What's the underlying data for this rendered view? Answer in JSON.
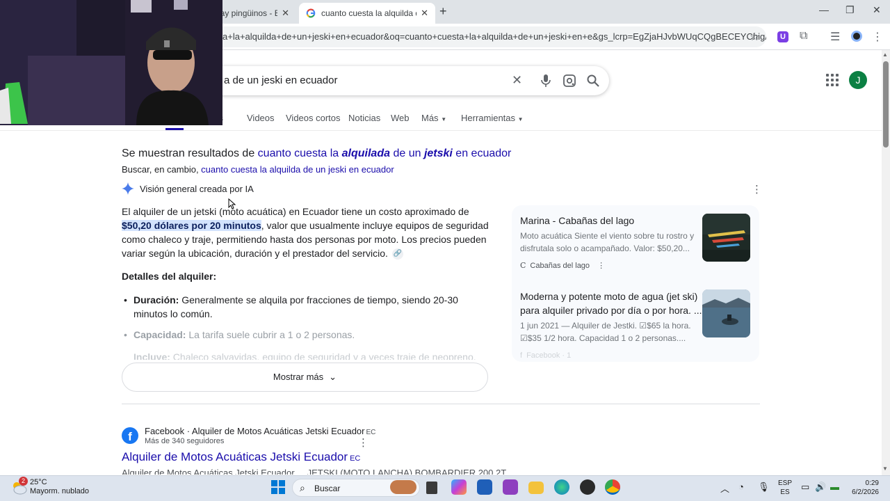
{
  "browser": {
    "tabs": [
      {
        "title": "hay pingüinos - B",
        "active": false
      },
      {
        "title": "cuanto cuesta la alquilda de un",
        "active": true
      }
    ],
    "new_tab_glyph": "+",
    "address": "a+la+alquilda+de+un+jeski+en+ecuador&oq=cuanto+cuesta+la+alquilda+de+un+jeski+en+e&gs_lcrp=EgZjaHJvbWUqCQgBECEYChigATIGC...",
    "window_controls": [
      "minimize-icon",
      "restore-icon",
      "close-icon"
    ],
    "extension_badge": "U"
  },
  "google": {
    "query": "a de un jeski en ecuador",
    "avatar_initial": "J",
    "nav_tabs": [
      "nes",
      "Videos",
      "Videos cortos",
      "Noticias",
      "Web",
      "Más",
      "Herramientas"
    ],
    "showing": {
      "prefix": "Se muestran resultados de ",
      "q1": "cuanto cuesta la ",
      "q2": "alquilada",
      "q3": " de un ",
      "q4": "jetski",
      "q5": " en ecuador"
    },
    "instead": {
      "prefix": "Buscar, en cambio, ",
      "link": "cuanto cuesta la alquilda de un jeski en ecuador"
    },
    "ai_overview": {
      "header": "Visión general creada por IA",
      "p_before": "El alquiler de un jetski (moto acuática) en Ecuador tiene un costo aproximado de ",
      "p_highlight": "$50,20 dólares por 20 minutos",
      "p_after": ", valor que usualmente incluye equipos de seguridad como chaleco y traje, permitiendo hasta dos personas por moto. Los precios pueden variar según la ubicación, duración y el prestador del servicio.",
      "details_heading": "Detalles del alquiler:",
      "bullets": [
        {
          "label": "Duración:",
          "text": " Generalmente se alquila por fracciones de tiempo, siendo 20-30 minutos lo común."
        },
        {
          "label": "Capacidad:",
          "text": " La tarifa suele cubrir a 1 o 2 personas."
        },
        {
          "label": "Incluye:",
          "text": " Chaleco salvavidas, equipo de seguridad y a veces traje de neopreno."
        }
      ],
      "show_more": "Mostrar más",
      "sources": [
        {
          "title": "Marina - Cabañas del lago",
          "snippet": "Moto acuática Siente el viento sobre tu rostro y disfrutala solo o acampañado. Valor: $50,20...",
          "source": "Cabañas del lago",
          "source_glyph": "C"
        },
        {
          "title": "Moderna y potente moto de agua (jet ski) para alquiler privado por día o por hora. ...",
          "snippet": "1 jun 2021 — Alquiler de Jestki. ☑$65 la hora. ☑$35 1/2 hora. Capacidad 1 o 2 personas....",
          "source": "Facebook · 1",
          "source_glyph": "f"
        }
      ]
    },
    "result": {
      "source": "Facebook · Alquiler de Motos Acuáticas Jetski Ecuador",
      "source_cc": "EC",
      "followers": "Más de 340 seguidores",
      "title": "Alquiler de Motos Acuáticas Jetski Ecuador",
      "title_cc": "EC",
      "snippet": "Alquiler de Motos Acuáticas Jetski Ecuador ... JETSKI (MOTO LANCHA) BOMBARDIER 200 2T"
    }
  },
  "taskbar": {
    "badge": "2",
    "temperature": "25°C",
    "weather": "Mayorm. nublado",
    "search": "Buscar",
    "lang_top": "ESP",
    "lang_bottom": "ES",
    "time": "0:29",
    "date": "6/2/2026"
  },
  "colors": {
    "link": "#1a0dab",
    "highlight": "#d3e3fd",
    "avatar": "#0b8043",
    "taskbar": "#dde4ee"
  }
}
